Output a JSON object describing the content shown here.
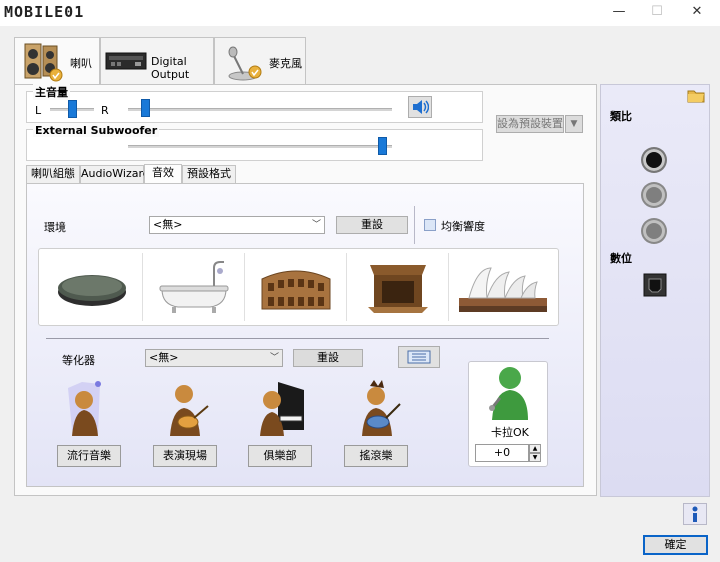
{
  "window": {
    "logo_text": "MOBILE01",
    "minimize_glyph": "—",
    "maximize_glyph": "☐",
    "close_glyph": "✕"
  },
  "device_tabs": [
    {
      "label": "喇叭",
      "icon": "speaker-icon",
      "active": true
    },
    {
      "label": "Digital Output",
      "icon": "digital-output-icon",
      "active": false
    },
    {
      "label": "麥克風",
      "icon": "microphone-icon",
      "active": false
    }
  ],
  "main_volume": {
    "title": "主音量",
    "left_label": "L",
    "right_label": "R",
    "balance": 0.5,
    "level": 0.05,
    "mute_icon": "speaker-volume-icon"
  },
  "subwoofer": {
    "title": "External Subwoofer",
    "level": 0.98
  },
  "set_default_button": "設為預設裝置",
  "sub_tabs": [
    {
      "label": "喇叭組態",
      "active": false
    },
    {
      "label": "AudioWizard",
      "active": false
    },
    {
      "label": "音效",
      "active": true
    },
    {
      "label": "預設格式",
      "active": false
    }
  ],
  "environment": {
    "label": "環境",
    "selected": "<無>",
    "reset_button": "重設",
    "loudness_label": "均衡響度",
    "loudness_checked": false,
    "presets": [
      {
        "icon": "stone-disc-icon"
      },
      {
        "icon": "bathtub-icon"
      },
      {
        "icon": "colosseum-icon"
      },
      {
        "icon": "wooden-room-icon"
      },
      {
        "icon": "opera-house-icon"
      }
    ]
  },
  "equalizer": {
    "label": "等化器",
    "selected": "<無>",
    "reset_button": "重設",
    "grid_icon": "equalizer-grid-icon",
    "presets": [
      {
        "label": "流行音樂",
        "icon": "pop-singer-icon"
      },
      {
        "label": "表演現場",
        "icon": "live-guitarist-icon"
      },
      {
        "label": "俱樂部",
        "icon": "piano-player-icon"
      },
      {
        "label": "搖滾樂",
        "icon": "rock-guitarist-icon"
      }
    ]
  },
  "karaoke": {
    "label": "卡拉OK",
    "value": "+0",
    "icon": "karaoke-singer-icon"
  },
  "right_panel": {
    "folder_icon": "folder-icon",
    "output_label": "類比",
    "digital_label": "數位",
    "jacks": [
      {
        "color": "#1a1a1a",
        "active": true
      },
      {
        "color": "#8a8a8a",
        "active": false
      },
      {
        "color": "#8a8a8a",
        "active": false
      }
    ],
    "digital_icon": "digital-port-icon"
  },
  "info_icon": "info-icon",
  "ok_button": "確定"
}
